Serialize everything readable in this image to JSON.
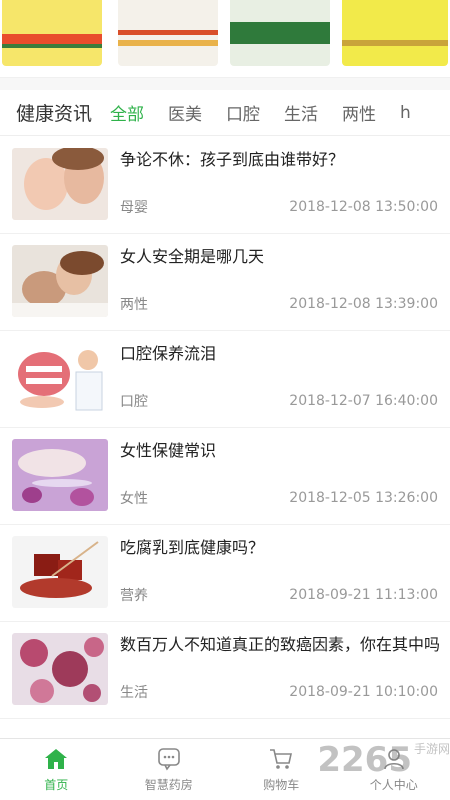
{
  "colors": {
    "accent": "#2fb24a"
  },
  "header": {
    "title": "健康资讯",
    "tabs": [
      {
        "label": "全部",
        "active": true
      },
      {
        "label": "医美",
        "active": false
      },
      {
        "label": "口腔",
        "active": false
      },
      {
        "label": "生活",
        "active": false
      },
      {
        "label": "两性",
        "active": false
      },
      {
        "label": "h",
        "active": false
      }
    ]
  },
  "articles": [
    {
      "title": "争论不休：孩子到底由谁带好？",
      "category": "母婴",
      "time": "2018-12-08 13:50:00"
    },
    {
      "title": "女人安全期是哪几天",
      "category": "两性",
      "time": "2018-12-08 13:39:00"
    },
    {
      "title": "口腔保养流泪",
      "category": "口腔",
      "time": "2018-12-07 16:40:00"
    },
    {
      "title": "女性保健常识",
      "category": "女性",
      "time": "2018-12-05 13:26:00"
    },
    {
      "title": "吃腐乳到底健康吗？",
      "category": "营养",
      "time": "2018-09-21 11:13:00"
    },
    {
      "title": "数百万人不知道真正的致癌因素，你在其中吗",
      "category": "生活",
      "time": "2018-09-21 10:10:00"
    }
  ],
  "bottom_nav": [
    {
      "label": "首页",
      "icon": "home-icon",
      "active": true
    },
    {
      "label": "智慧药房",
      "icon": "chat-icon",
      "active": false
    },
    {
      "label": "购物车",
      "icon": "cart-icon",
      "active": false
    },
    {
      "label": "个人中心",
      "icon": "user-icon",
      "active": false
    }
  ],
  "watermark": {
    "text": "2265",
    "suffix": "手游网"
  }
}
